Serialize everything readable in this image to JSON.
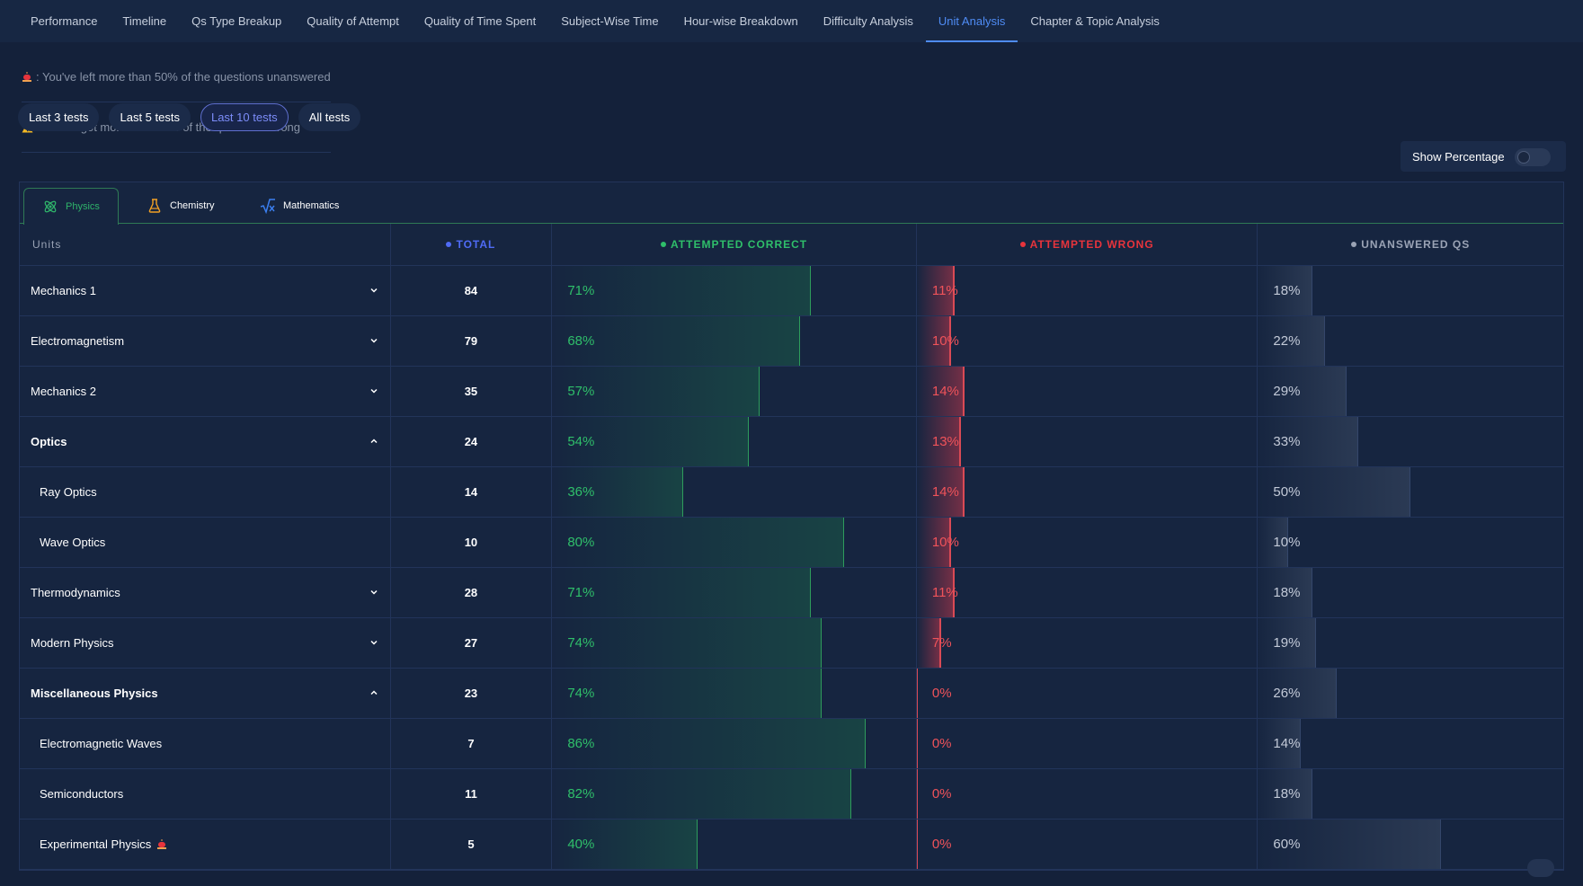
{
  "nav": {
    "tabs": [
      {
        "label": "Performance"
      },
      {
        "label": "Timeline"
      },
      {
        "label": "Qs Type Breakup"
      },
      {
        "label": "Quality of Attempt"
      },
      {
        "label": "Quality of Time Spent"
      },
      {
        "label": "Subject-Wise Time"
      },
      {
        "label": "Hour-wise Breakdown"
      },
      {
        "label": "Difficulty Analysis"
      },
      {
        "label": "Unit Analysis"
      },
      {
        "label": "Chapter & Topic Analysis"
      }
    ],
    "active": "Unit Analysis"
  },
  "legend": {
    "unanswered": ": You've left more than 50% of the questions unanswered",
    "wrong": ": You've got more than 50% of the questions wrong"
  },
  "filters": {
    "options": [
      {
        "label": "Last 3 tests"
      },
      {
        "label": "Last 5 tests"
      },
      {
        "label": "Last 10 tests"
      },
      {
        "label": "All tests"
      }
    ],
    "active": "Last 10 tests"
  },
  "show_percentage": {
    "label": "Show Percentage",
    "enabled": false
  },
  "subjects": {
    "tabs": [
      {
        "label": "Physics",
        "icon": "atom-icon"
      },
      {
        "label": "Chemistry",
        "icon": "flask-icon"
      },
      {
        "label": "Mathematics",
        "icon": "sqrt-icon"
      }
    ],
    "active": "Physics"
  },
  "table": {
    "headers": {
      "units": "Units",
      "total": "TOTAL",
      "correct": "ATTEMPTED CORRECT",
      "wrong": "ATTEMPTED WRONG",
      "unanswered": "UNANSWERED QS"
    },
    "colors": {
      "total": "#4f6bf5",
      "correct": "#2fbf6a",
      "wrong": "#e8343c",
      "unanswered": "#9aa3b5"
    },
    "rows": [
      {
        "unit": "Mechanics 1",
        "total": "84",
        "correct": "71%",
        "wrong": "11%",
        "unanswered": "18%",
        "level": 0,
        "expander": "down"
      },
      {
        "unit": "Electromagnetism",
        "total": "79",
        "correct": "68%",
        "wrong": "10%",
        "unanswered": "22%",
        "level": 0,
        "expander": "down"
      },
      {
        "unit": "Mechanics 2",
        "total": "35",
        "correct": "57%",
        "wrong": "14%",
        "unanswered": "29%",
        "level": 0,
        "expander": "down"
      },
      {
        "unit": "Optics",
        "total": "24",
        "correct": "54%",
        "wrong": "13%",
        "unanswered": "33%",
        "level": 0,
        "expander": "up",
        "bold": true
      },
      {
        "unit": "Ray Optics",
        "total": "14",
        "correct": "36%",
        "wrong": "14%",
        "unanswered": "50%",
        "level": 1
      },
      {
        "unit": "Wave Optics",
        "total": "10",
        "correct": "80%",
        "wrong": "10%",
        "unanswered": "10%",
        "level": 1
      },
      {
        "unit": "Thermodynamics",
        "total": "28",
        "correct": "71%",
        "wrong": "11%",
        "unanswered": "18%",
        "level": 0,
        "expander": "down"
      },
      {
        "unit": "Modern Physics",
        "total": "27",
        "correct": "74%",
        "wrong": "7%",
        "unanswered": "19%",
        "level": 0,
        "expander": "down"
      },
      {
        "unit": "Miscellaneous Physics",
        "total": "23",
        "correct": "74%",
        "wrong": "0%",
        "unanswered": "26%",
        "level": 0,
        "expander": "up",
        "bold": true
      },
      {
        "unit": "Electromagnetic Waves",
        "total": "7",
        "correct": "86%",
        "wrong": "0%",
        "unanswered": "14%",
        "level": 1
      },
      {
        "unit": "Semiconductors",
        "total": "11",
        "correct": "82%",
        "wrong": "0%",
        "unanswered": "18%",
        "level": 1
      },
      {
        "unit": "Experimental Physics",
        "total": "5",
        "correct": "40%",
        "wrong": "0%",
        "unanswered": "60%",
        "level": 1,
        "flag": "siren-icon"
      }
    ]
  }
}
